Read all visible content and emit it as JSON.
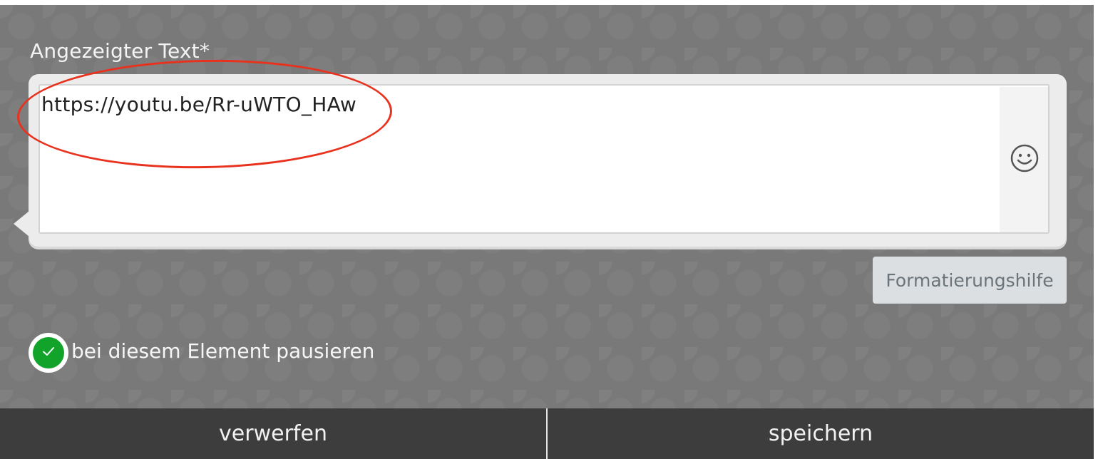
{
  "field": {
    "label": "Angezeigter Text*",
    "value": "https://youtu.be/Rr-uWTO_HAw"
  },
  "toolbar": {
    "emoji_icon": "smiley-icon",
    "format_help_label": "Formatierungshilfe"
  },
  "pause_option": {
    "checked": true,
    "label": "bei diesem Element pausieren"
  },
  "footer": {
    "discard_label": "verwerfen",
    "save_label": "speichern"
  },
  "colors": {
    "panel_bg": "#797979",
    "footer_bg": "#3d3d3d",
    "check_green": "#12a42a",
    "annotation_red": "#e8321e"
  }
}
